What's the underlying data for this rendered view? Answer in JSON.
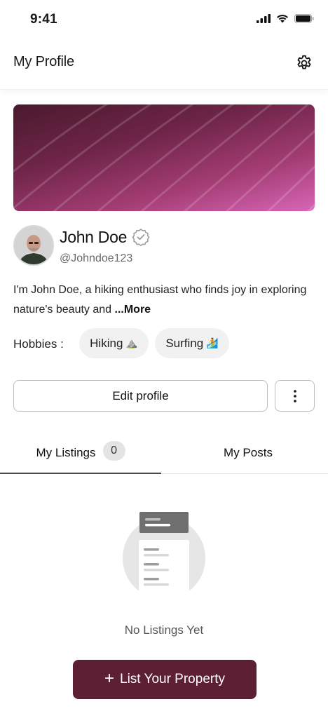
{
  "status_bar": {
    "time": "9:41"
  },
  "header": {
    "title": "My Profile",
    "settings_icon": "gear-icon"
  },
  "profile": {
    "name": "John Doe",
    "handle": "@Johndoe123",
    "verified_icon": "verified-badge-icon",
    "bio_text": "I'm John Doe, a hiking enthusiast who finds joy in exploring nature's beauty and ",
    "bio_more": "...More"
  },
  "hobbies": {
    "label": "Hobbies :",
    "items": [
      {
        "label": "Hiking",
        "emoji": "⛰️"
      },
      {
        "label": "Surfing",
        "emoji": "🏄"
      }
    ]
  },
  "actions": {
    "edit_label": "Edit profile",
    "more_icon": "vertical-dots-icon"
  },
  "tabs": [
    {
      "label": "My Listings",
      "count": "0",
      "active": true
    },
    {
      "label": "My Posts",
      "active": false
    }
  ],
  "empty_state": {
    "text": "No Listings Yet"
  },
  "cta": {
    "label": "List Your Property",
    "icon": "plus-icon"
  },
  "colors": {
    "brand": "#5c1f33",
    "cover_start": "#4a1a2e",
    "cover_end": "#d866b7"
  }
}
